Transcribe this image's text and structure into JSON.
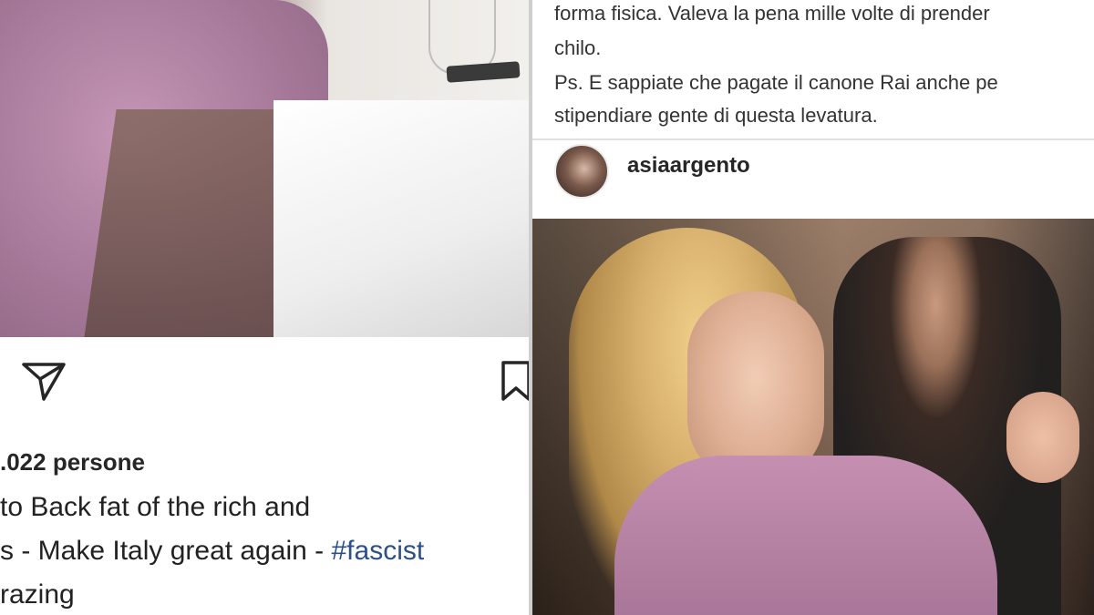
{
  "left_post": {
    "likes_text": ".022 persone",
    "caption_lines": [
      "to Back fat of the rich and",
      "s - Make Italy great again - ",
      "razing"
    ],
    "hashtag": "#fascist",
    "icons": [
      "send-icon",
      "bookmark-icon"
    ],
    "hashtag_color": "#2b4f86"
  },
  "right_post": {
    "text_lines": [
      "forma fisica. Valeva la pena mille volte di prender",
      "chilo.",
      "Ps. E sappiate che pagate il canone Rai anche pe",
      "stipendiare gente di questa levatura."
    ],
    "username": "asiaargento"
  }
}
